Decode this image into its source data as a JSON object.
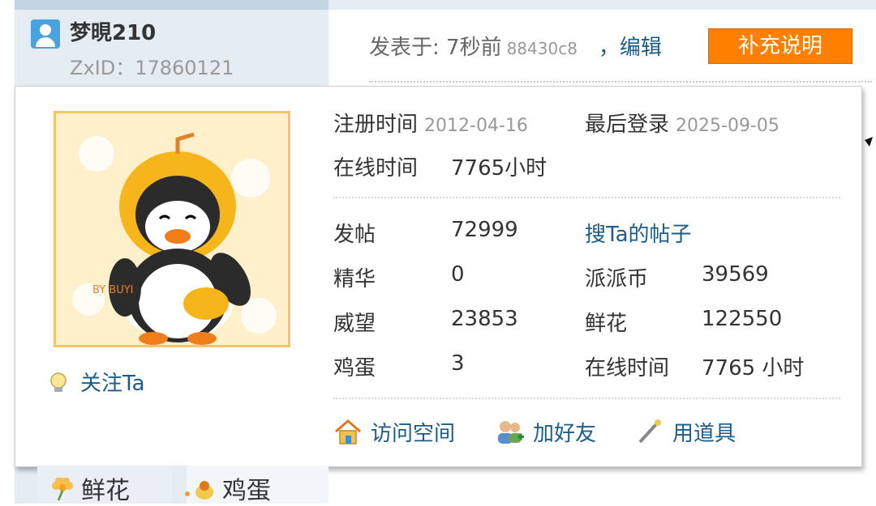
{
  "author": {
    "name": "梦晛210",
    "zxid": "ZxID：17860121"
  },
  "post": {
    "posted_label": "发表于: 7秒前",
    "hash": "88430c8",
    "edit_label": "，编辑",
    "supplement_button": "补充说明"
  },
  "card": {
    "register_label": "注册时间",
    "register_value": "2012-04-16",
    "last_login_label": "最后登录",
    "last_login_value": "2025-09-05",
    "online_label": "在线时间",
    "online_value": "7765小时",
    "stats": [
      {
        "label": "发帖",
        "value": "72999"
      },
      {
        "label": "精华",
        "value": "0"
      },
      {
        "label": "威望",
        "value": "23853"
      },
      {
        "label": "鸡蛋",
        "value": "3"
      }
    ],
    "search_posts_link": "搜Ta的帖子",
    "stats_right": [
      {
        "label": "派派币",
        "value": "39569"
      },
      {
        "label": "鲜花",
        "value": "122550"
      },
      {
        "label": "在线时间",
        "value": "7765 小时"
      }
    ],
    "follow_label": "关注Ta",
    "avatar_text": "BY BUYI",
    "actions": {
      "visit_space": "访问空间",
      "add_friend": "加好友",
      "use_item": "用道具"
    }
  },
  "bottom_tabs": {
    "flower": "鲜花",
    "egg": "鸡蛋"
  },
  "colors": {
    "accent_orange": "#ff7f00",
    "link_blue": "#1a5d8c",
    "panel_blue": "#e5edf2"
  }
}
